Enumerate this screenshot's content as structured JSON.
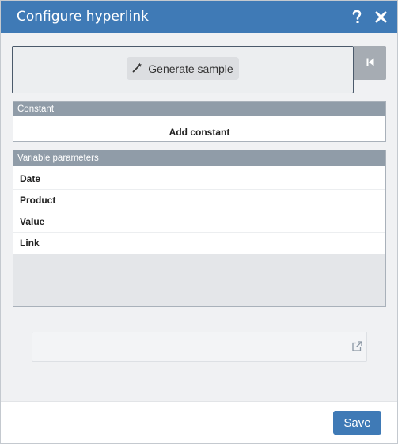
{
  "dialog": {
    "title": "Configure hyperlink",
    "help_icon": "question-icon",
    "close_icon": "close-icon"
  },
  "generate": {
    "label": "Generate sample",
    "icon": "magic-wand-icon",
    "side_icon": "skip-to-start-icon"
  },
  "constant": {
    "header": "Constant",
    "add_label": "Add constant"
  },
  "variables": {
    "header": "Variable parameters",
    "items": [
      {
        "label": "Date"
      },
      {
        "label": "Product"
      },
      {
        "label": "Value"
      },
      {
        "label": "Link"
      }
    ]
  },
  "link": {
    "value": "",
    "placeholder": "",
    "icon": "external-link-icon"
  },
  "footer": {
    "save_label": "Save"
  },
  "colors": {
    "title_bar": "#3f7ab6",
    "panel_header": "#909ca8",
    "save_button": "#3f7ab6"
  }
}
